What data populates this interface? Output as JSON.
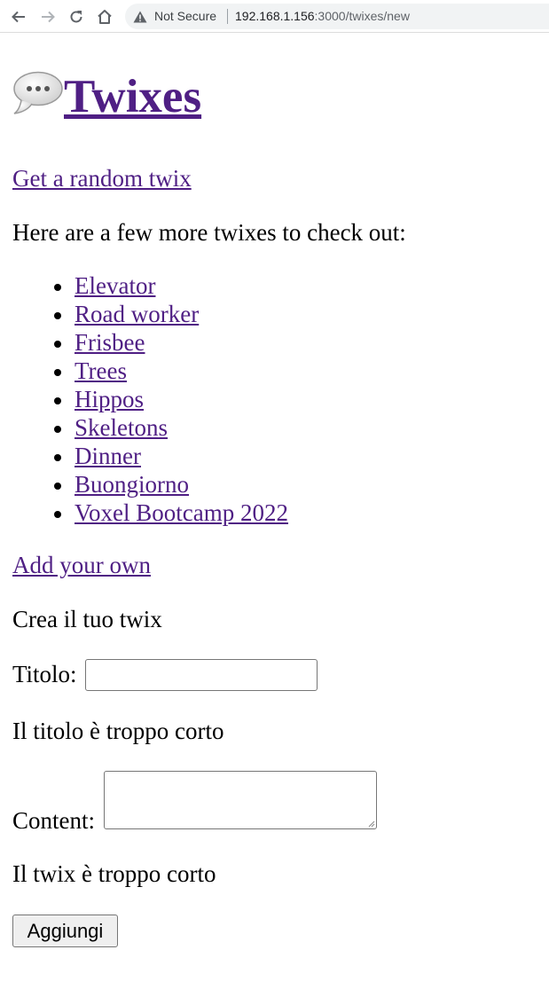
{
  "browser": {
    "security_label": "Not Secure",
    "url_host": "192.168.1.156",
    "url_path": ":3000/twixes/new"
  },
  "header": {
    "logo_icon": "speech-bubble-icon",
    "title": "Twixes"
  },
  "random_link": "Get a random twix",
  "more_text": "Here are a few more twixes to check out:",
  "twixes": [
    "Elevator",
    "Road worker",
    "Frisbee",
    "Trees",
    "Hippos",
    "Skeletons",
    "Dinner",
    "Buongiorno",
    "Voxel Bootcamp 2022"
  ],
  "add_own_link": "Add your own",
  "form": {
    "heading": "Crea il tuo twix",
    "title_label": "Titolo:",
    "title_value": "",
    "title_error": "Il titolo è troppo corto",
    "content_label": "Content:",
    "content_value": "",
    "content_error": "Il twix è troppo corto",
    "submit_label": "Aggiungi"
  },
  "colors": {
    "link": "#4f1f84",
    "toolbar_bg": "#ffffff",
    "omnibox_bg": "#f1f3f4"
  }
}
